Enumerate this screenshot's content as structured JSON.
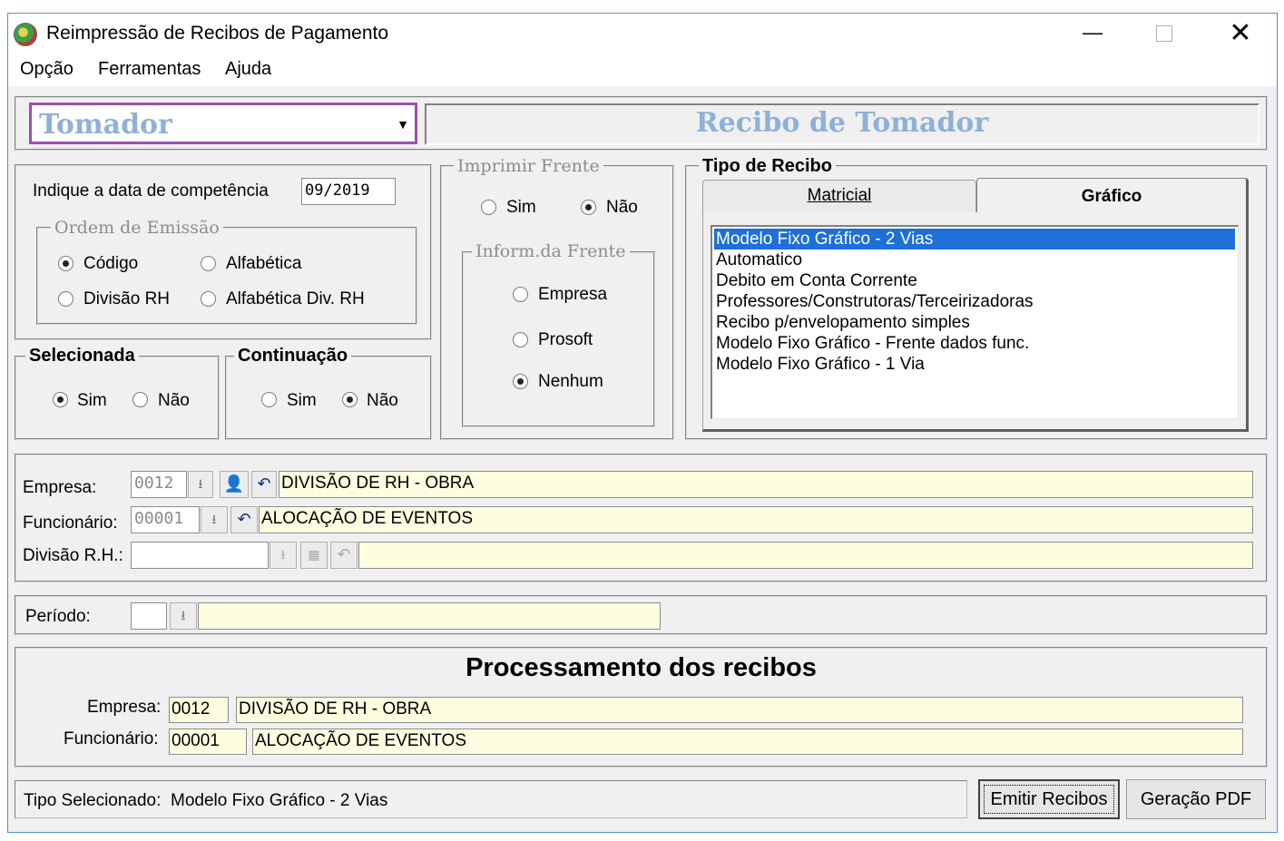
{
  "window": {
    "title": "Reimpressão de Recibos de Pagamento"
  },
  "menu": [
    "Opção",
    "Ferramentas",
    "Ajuda"
  ],
  "top": {
    "combo_value": "Tomador",
    "banner": "Recibo de Tomador"
  },
  "competencia": {
    "label": "Indique a data de competência",
    "value": "09/2019"
  },
  "ordem": {
    "title": "Ordem de Emissão",
    "options": [
      "Código",
      "Alfabética",
      "Divisão RH",
      "Alfabética Div.  RH"
    ],
    "selected": "Código"
  },
  "selecionada": {
    "title": "Selecionada",
    "sim": "Sim",
    "nao": "Não",
    "selected": "Sim"
  },
  "continuacao": {
    "title": "Continuação",
    "sim": "Sim",
    "nao": "Não",
    "selected": "Não"
  },
  "imprimir_frente": {
    "title": "Imprimir Frente",
    "sim": "Sim",
    "nao": "Não",
    "selected": "Não"
  },
  "inform_frente": {
    "title": "Inform.da Frente",
    "options": [
      "Empresa",
      "Prosoft",
      "Nenhum"
    ],
    "selected": "Nenhum"
  },
  "tipo_recibo": {
    "title": "Tipo de Recibo",
    "tabs": [
      "Matricial",
      "Gráfico"
    ],
    "active_tab": "Gráfico",
    "items": [
      "Modelo Fixo Gráfico - 2 Vias",
      "Automatico",
      "Debito em Conta Corrente",
      "Professores/Construtoras/Terceirizadoras",
      "Recibo p/envelopamento simples",
      "Modelo Fixo Gráfico - Frente dados func.",
      "Modelo Fixo Gráfico - 1 Via"
    ],
    "selected_index": 0
  },
  "filtros": {
    "empresa": {
      "label": "Empresa:",
      "code": "0012",
      "name": "DIVISÃO DE RH - OBRA"
    },
    "funcionario": {
      "label": "Funcionário:",
      "code": "00001",
      "name": "ALOCAÇÃO DE EVENTOS"
    },
    "divisao": {
      "label": "Divisão R.H.:",
      "code": "",
      "name": ""
    }
  },
  "periodo": {
    "label": "Período:",
    "code": "",
    "name": ""
  },
  "processamento": {
    "title": "Processamento dos recibos",
    "empresa_label": "Empresa:",
    "empresa_code": "0012",
    "empresa_name": "DIVISÃO DE RH - OBRA",
    "func_label": "Funcionário:",
    "func_code": "00001",
    "func_name": "ALOCAÇÃO DE EVENTOS"
  },
  "status": {
    "label": "Tipo Selecionado:",
    "value": "Modelo Fixo Gráfico - 2 Vias"
  },
  "buttons": {
    "emitir": "Emitir Recibos",
    "pdf": "Geração PDF"
  },
  "colors": {
    "combo_border": "#9b4fb0",
    "banner_text": "#8fb0d8",
    "selection": "#1e6fd8",
    "field_yellow": "#fffde0"
  }
}
